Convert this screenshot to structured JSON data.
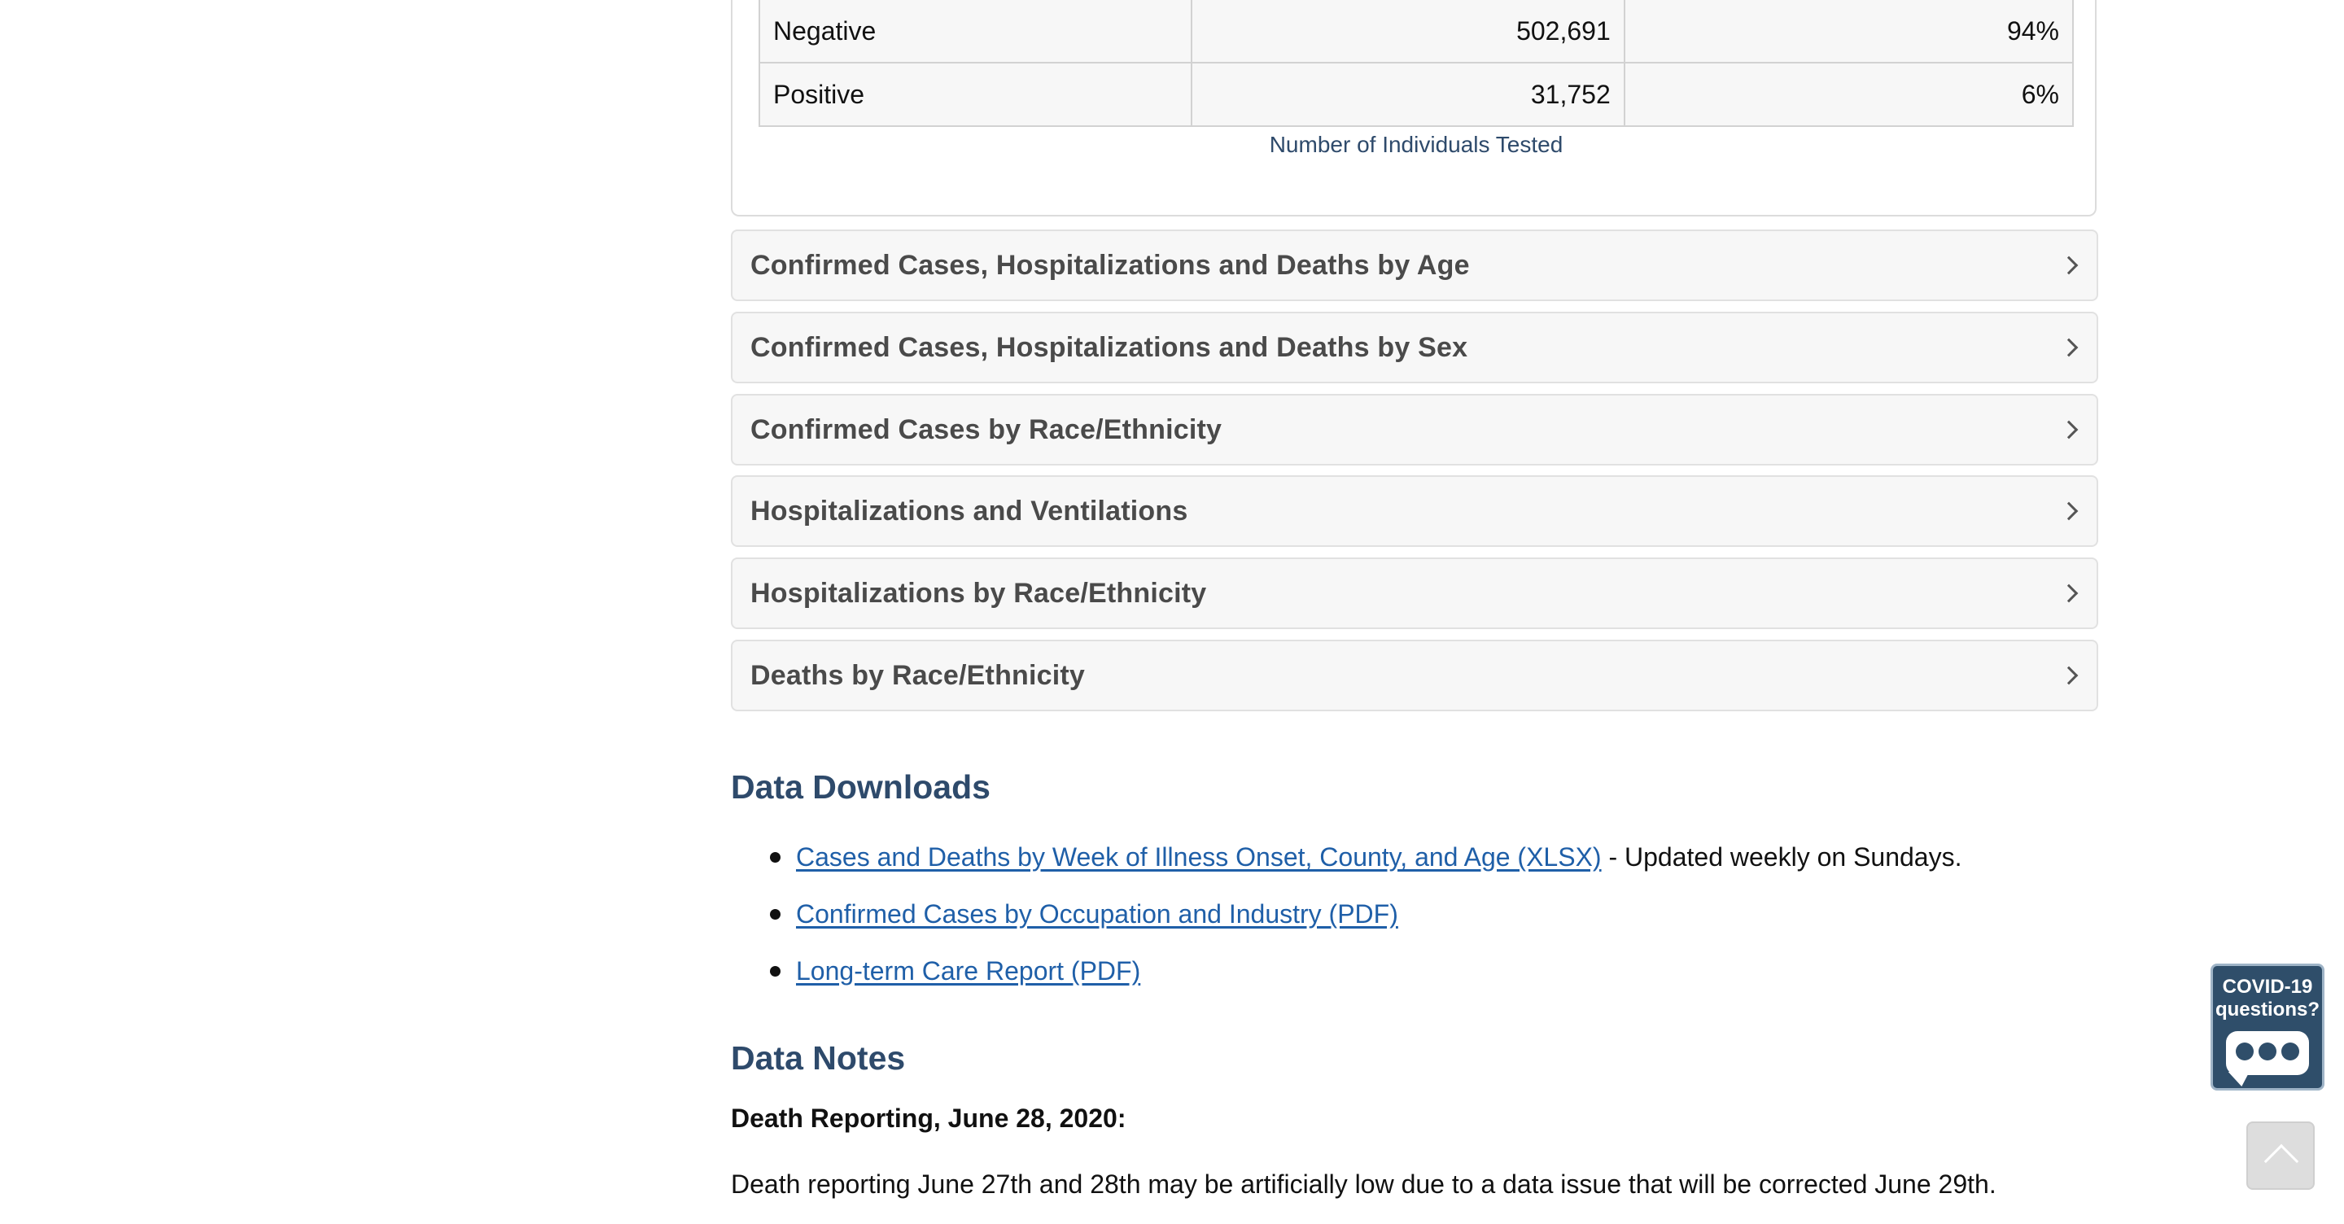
{
  "testing_table": {
    "rows": [
      {
        "label": "Negative",
        "count": "502,691",
        "percent": "94%"
      },
      {
        "label": "Positive",
        "count": "31,752",
        "percent": "6%"
      }
    ],
    "caption": "Number of Individuals Tested"
  },
  "accordions": [
    {
      "title": "Confirmed Cases, Hospitalizations and Deaths by Age"
    },
    {
      "title": "Confirmed Cases, Hospitalizations and Deaths by Sex"
    },
    {
      "title": "Confirmed Cases by Race/Ethnicity"
    },
    {
      "title": "Hospitalizations and Ventilations"
    },
    {
      "title": "Hospitalizations by Race/Ethnicity"
    },
    {
      "title": "Deaths by Race/Ethnicity"
    }
  ],
  "data_downloads": {
    "heading": "Data Downloads",
    "items": [
      {
        "link": "Cases and Deaths by Week of Illness Onset, County, and Age (XLSX)",
        "suffix": " - Updated weekly on Sundays."
      },
      {
        "link": "Confirmed Cases by Occupation and Industry (PDF)",
        "suffix": ""
      },
      {
        "link": "Long-term Care Report (PDF)",
        "suffix": ""
      }
    ]
  },
  "data_notes": {
    "heading": "Data Notes",
    "note_title": "Death Reporting, June 28, 2020:",
    "note_body": "Death reporting June 27th and 28th may be artificially low due to a data issue that will be corrected June 29th."
  },
  "chat_widget": {
    "line1": "COVID-19",
    "line2": "questions?",
    "icon": "chat-bubble-icon"
  },
  "scroll_top": {
    "icon": "arrow-up-icon"
  }
}
